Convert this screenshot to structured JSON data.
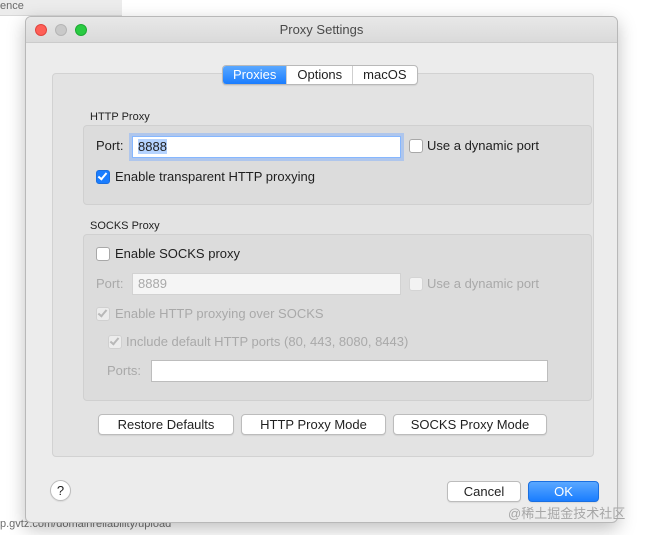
{
  "background": {
    "top_left_text": "ence",
    "bottom_left_text": "p.gvtz.com/domainreliability/upload",
    "watermark": "@稀土掘金技术社区"
  },
  "window": {
    "title": "Proxy Settings",
    "tabs": [
      {
        "label": "Proxies",
        "active": true
      },
      {
        "label": "Options",
        "active": false
      },
      {
        "label": "macOS",
        "active": false
      }
    ]
  },
  "http_proxy": {
    "group_label": "HTTP Proxy",
    "port_label": "Port:",
    "port_value": "8888",
    "dynamic_port_label": "Use a dynamic port",
    "dynamic_port_checked": false,
    "transparent_label": "Enable transparent HTTP proxying",
    "transparent_checked": true
  },
  "socks_proxy": {
    "group_label": "SOCKS Proxy",
    "enable_label": "Enable SOCKS proxy",
    "enable_checked": false,
    "port_label": "Port:",
    "port_placeholder": "8889",
    "dynamic_port_label": "Use a dynamic port",
    "http_over_socks_label": "Enable HTTP proxying over SOCKS",
    "default_ports_label": "Include default HTTP ports (80, 443, 8080, 8443)",
    "ports_label": "Ports:",
    "ports_value": ""
  },
  "buttons": {
    "restore_defaults": "Restore Defaults",
    "http_proxy_mode": "HTTP Proxy Mode",
    "socks_proxy_mode": "SOCKS Proxy Mode",
    "help": "?",
    "cancel": "Cancel",
    "ok": "OK"
  },
  "colors": {
    "accent": "#1a7dff",
    "window_bg": "#ececec",
    "close": "#fe5f57",
    "maximize": "#2acb42"
  }
}
